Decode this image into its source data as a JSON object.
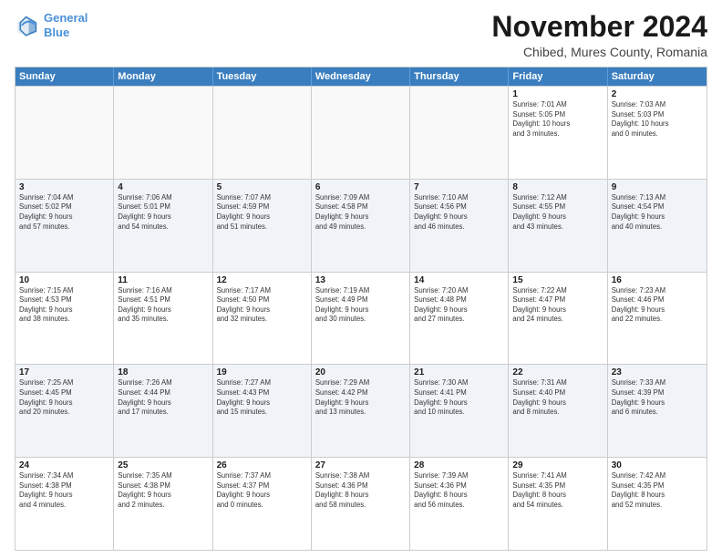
{
  "logo": {
    "line1": "General",
    "line2": "Blue"
  },
  "header": {
    "title": "November 2024",
    "subtitle": "Chibed, Mures County, Romania"
  },
  "calendar": {
    "days_of_week": [
      "Sunday",
      "Monday",
      "Tuesday",
      "Wednesday",
      "Thursday",
      "Friday",
      "Saturday"
    ],
    "rows": [
      [
        {
          "day": "",
          "info": "",
          "empty": true
        },
        {
          "day": "",
          "info": "",
          "empty": true
        },
        {
          "day": "",
          "info": "",
          "empty": true
        },
        {
          "day": "",
          "info": "",
          "empty": true
        },
        {
          "day": "",
          "info": "",
          "empty": true
        },
        {
          "day": "1",
          "info": "Sunrise: 7:01 AM\nSunset: 5:05 PM\nDaylight: 10 hours\nand 3 minutes.",
          "empty": false
        },
        {
          "day": "2",
          "info": "Sunrise: 7:03 AM\nSunset: 5:03 PM\nDaylight: 10 hours\nand 0 minutes.",
          "empty": false
        }
      ],
      [
        {
          "day": "3",
          "info": "Sunrise: 7:04 AM\nSunset: 5:02 PM\nDaylight: 9 hours\nand 57 minutes.",
          "empty": false
        },
        {
          "day": "4",
          "info": "Sunrise: 7:06 AM\nSunset: 5:01 PM\nDaylight: 9 hours\nand 54 minutes.",
          "empty": false
        },
        {
          "day": "5",
          "info": "Sunrise: 7:07 AM\nSunset: 4:59 PM\nDaylight: 9 hours\nand 51 minutes.",
          "empty": false
        },
        {
          "day": "6",
          "info": "Sunrise: 7:09 AM\nSunset: 4:58 PM\nDaylight: 9 hours\nand 49 minutes.",
          "empty": false
        },
        {
          "day": "7",
          "info": "Sunrise: 7:10 AM\nSunset: 4:56 PM\nDaylight: 9 hours\nand 46 minutes.",
          "empty": false
        },
        {
          "day": "8",
          "info": "Sunrise: 7:12 AM\nSunset: 4:55 PM\nDaylight: 9 hours\nand 43 minutes.",
          "empty": false
        },
        {
          "day": "9",
          "info": "Sunrise: 7:13 AM\nSunset: 4:54 PM\nDaylight: 9 hours\nand 40 minutes.",
          "empty": false
        }
      ],
      [
        {
          "day": "10",
          "info": "Sunrise: 7:15 AM\nSunset: 4:53 PM\nDaylight: 9 hours\nand 38 minutes.",
          "empty": false
        },
        {
          "day": "11",
          "info": "Sunrise: 7:16 AM\nSunset: 4:51 PM\nDaylight: 9 hours\nand 35 minutes.",
          "empty": false
        },
        {
          "day": "12",
          "info": "Sunrise: 7:17 AM\nSunset: 4:50 PM\nDaylight: 9 hours\nand 32 minutes.",
          "empty": false
        },
        {
          "day": "13",
          "info": "Sunrise: 7:19 AM\nSunset: 4:49 PM\nDaylight: 9 hours\nand 30 minutes.",
          "empty": false
        },
        {
          "day": "14",
          "info": "Sunrise: 7:20 AM\nSunset: 4:48 PM\nDaylight: 9 hours\nand 27 minutes.",
          "empty": false
        },
        {
          "day": "15",
          "info": "Sunrise: 7:22 AM\nSunset: 4:47 PM\nDaylight: 9 hours\nand 24 minutes.",
          "empty": false
        },
        {
          "day": "16",
          "info": "Sunrise: 7:23 AM\nSunset: 4:46 PM\nDaylight: 9 hours\nand 22 minutes.",
          "empty": false
        }
      ],
      [
        {
          "day": "17",
          "info": "Sunrise: 7:25 AM\nSunset: 4:45 PM\nDaylight: 9 hours\nand 20 minutes.",
          "empty": false
        },
        {
          "day": "18",
          "info": "Sunrise: 7:26 AM\nSunset: 4:44 PM\nDaylight: 9 hours\nand 17 minutes.",
          "empty": false
        },
        {
          "day": "19",
          "info": "Sunrise: 7:27 AM\nSunset: 4:43 PM\nDaylight: 9 hours\nand 15 minutes.",
          "empty": false
        },
        {
          "day": "20",
          "info": "Sunrise: 7:29 AM\nSunset: 4:42 PM\nDaylight: 9 hours\nand 13 minutes.",
          "empty": false
        },
        {
          "day": "21",
          "info": "Sunrise: 7:30 AM\nSunset: 4:41 PM\nDaylight: 9 hours\nand 10 minutes.",
          "empty": false
        },
        {
          "day": "22",
          "info": "Sunrise: 7:31 AM\nSunset: 4:40 PM\nDaylight: 9 hours\nand 8 minutes.",
          "empty": false
        },
        {
          "day": "23",
          "info": "Sunrise: 7:33 AM\nSunset: 4:39 PM\nDaylight: 9 hours\nand 6 minutes.",
          "empty": false
        }
      ],
      [
        {
          "day": "24",
          "info": "Sunrise: 7:34 AM\nSunset: 4:38 PM\nDaylight: 9 hours\nand 4 minutes.",
          "empty": false
        },
        {
          "day": "25",
          "info": "Sunrise: 7:35 AM\nSunset: 4:38 PM\nDaylight: 9 hours\nand 2 minutes.",
          "empty": false
        },
        {
          "day": "26",
          "info": "Sunrise: 7:37 AM\nSunset: 4:37 PM\nDaylight: 9 hours\nand 0 minutes.",
          "empty": false
        },
        {
          "day": "27",
          "info": "Sunrise: 7:38 AM\nSunset: 4:36 PM\nDaylight: 8 hours\nand 58 minutes.",
          "empty": false
        },
        {
          "day": "28",
          "info": "Sunrise: 7:39 AM\nSunset: 4:36 PM\nDaylight: 8 hours\nand 56 minutes.",
          "empty": false
        },
        {
          "day": "29",
          "info": "Sunrise: 7:41 AM\nSunset: 4:35 PM\nDaylight: 8 hours\nand 54 minutes.",
          "empty": false
        },
        {
          "day": "30",
          "info": "Sunrise: 7:42 AM\nSunset: 4:35 PM\nDaylight: 8 hours\nand 52 minutes.",
          "empty": false
        }
      ]
    ]
  }
}
